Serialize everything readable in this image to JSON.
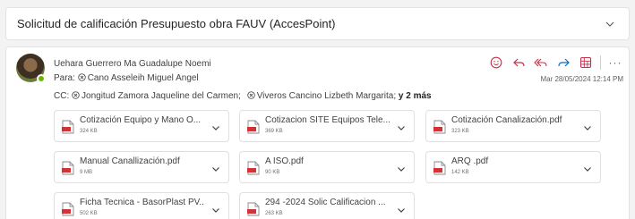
{
  "subject": {
    "text": "Solicitud de calificación Presupuesto obra FAUV (AccesPoint)"
  },
  "message": {
    "sender": "Uehara Guerrero Ma Guadalupe Noemi",
    "to_label": "Para:",
    "to": "Cano Asseleih Miguel Angel",
    "cc_label": "CC:",
    "cc": [
      "Jongitud Zamora Jaqueline del Carmen;",
      "Viveros Cancino Lizbeth Margarita;"
    ],
    "cc_more": "y 2 más",
    "datetime": "Mar 28/05/2024 12:14 PM",
    "more_actions": "···"
  },
  "attachments": [
    {
      "name": "Cotización Equipo y Mano O...",
      "size": "324 KB"
    },
    {
      "name": "Cotizacion SITE Equipos Tele...",
      "size": "369 KB"
    },
    {
      "name": "Cotización Canalización.pdf",
      "size": "323 KB"
    },
    {
      "name": "Manual Canallización.pdf",
      "size": "9 MB"
    },
    {
      "name": "A ISO.pdf",
      "size": "90 KB"
    },
    {
      "name": "ARQ .pdf",
      "size": "142 KB"
    },
    {
      "name": "Ficha Tecnica - BasorPlast PV...",
      "size": "502 KB"
    },
    {
      "name": "294 -2024 Solic Calificacion ...",
      "size": "263 KB"
    }
  ],
  "colors": {
    "accent_red": "#c4314b",
    "accent_blue": "#0f6cbd",
    "presence": "#6bb700"
  },
  "icons": {
    "toolbar": [
      "emoji-icon",
      "reply-icon",
      "reply-all-icon",
      "forward-icon",
      "apps-icon",
      "more-icon"
    ],
    "attachment": "pdf-file-icon"
  }
}
